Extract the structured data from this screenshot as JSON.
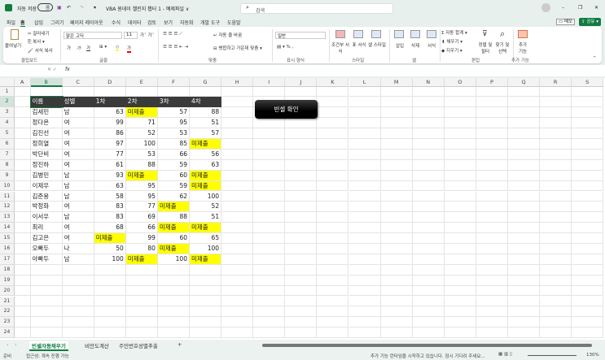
{
  "titlebar": {
    "autosave": "자동 저장",
    "toggle": "끔",
    "title": "VBA 원데이 챌린지 챕터 1 - 예제파일 ∨",
    "search_placeholder": "검색"
  },
  "tabs": [
    "파일",
    "홈",
    "삽입",
    "그리기",
    "페이지 레이아웃",
    "수식",
    "데이터",
    "검토",
    "보기",
    "자동화",
    "개발 도구",
    "도움말"
  ],
  "actions": {
    "memo": "메모",
    "share": "공유"
  },
  "ribbon": {
    "clipboard": {
      "paste": "붙여넣기",
      "cut": "잘라내기",
      "copy": "복사",
      "format_painter": "서식 복사",
      "label": "클립보드"
    },
    "font": {
      "name": "맑은 고딕",
      "size": "11",
      "bold": "가",
      "italic": "가",
      "underline": "가",
      "label": "글꼴"
    },
    "alignment": {
      "wrap": "자동 줄 바꿈",
      "merge": "병합하고 가운데 맞춤",
      "label": "맞춤"
    },
    "number": {
      "format": "일반",
      "percent": "%",
      "label": "표시 형식"
    },
    "styles": {
      "conditional": "조건부 서식",
      "table": "표 서식",
      "cell_styles": "셀 스타일",
      "label": "스타일"
    },
    "cells": {
      "insert": "삽입",
      "delete": "삭제",
      "format": "서식",
      "label": "셀"
    },
    "editing": {
      "autosum": "자동 합계",
      "fill": "채우기",
      "clear": "지우기",
      "sort": "정렬 및 필터",
      "find": "찾기 및 선택",
      "label": "편집"
    },
    "addins": {
      "addins": "추가 기능",
      "label": "추가 기능"
    }
  },
  "formula_bar": {
    "name_box": "B2",
    "fx": "fx",
    "value": "이름"
  },
  "columns": [
    "A",
    "B",
    "C",
    "D",
    "E",
    "F",
    "G",
    "H",
    "I",
    "J",
    "K",
    "L",
    "M",
    "N",
    "O",
    "P",
    "Q",
    "R",
    "S"
  ],
  "rows": [
    "1",
    "2",
    "3",
    "4",
    "5",
    "6",
    "7",
    "8",
    "9",
    "10",
    "11",
    "12",
    "13",
    "14",
    "15",
    "16",
    "17",
    "18",
    "19",
    "20",
    "21",
    "22",
    "23",
    "24"
  ],
  "table": {
    "headers": [
      "이름",
      "성별",
      "1차",
      "2차",
      "3차",
      "4차"
    ],
    "rows": [
      [
        "김세민",
        "남",
        "63",
        "미제출",
        "57",
        "88"
      ],
      [
        "정다온",
        "여",
        "99",
        "71",
        "95",
        "51"
      ],
      [
        "김진선",
        "여",
        "86",
        "52",
        "53",
        "57"
      ],
      [
        "정희열",
        "여",
        "97",
        "100",
        "85",
        "미제출"
      ],
      [
        "박단비",
        "여",
        "77",
        "53",
        "66",
        "56"
      ],
      [
        "정진하",
        "여",
        "61",
        "88",
        "59",
        "63"
      ],
      [
        "김병민",
        "남",
        "93",
        "미제출",
        "60",
        "미제출"
      ],
      [
        "이제우",
        "남",
        "63",
        "95",
        "59",
        "미제출"
      ],
      [
        "김준용",
        "남",
        "58",
        "95",
        "62",
        "100"
      ],
      [
        "박정화",
        "여",
        "83",
        "77",
        "미제출",
        "52"
      ],
      [
        "이서우",
        "남",
        "83",
        "69",
        "88",
        "51"
      ],
      [
        "최리",
        "여",
        "68",
        "66",
        "미제출",
        "미제출"
      ],
      [
        "김고은",
        "여",
        "미제출",
        "99",
        "60",
        "65"
      ],
      [
        "오빠두",
        "나",
        "50",
        "80",
        "미제출",
        "100"
      ],
      [
        "아빠두",
        "남",
        "100",
        "미제출",
        "100",
        "미제출"
      ]
    ]
  },
  "highlight_color": "#ffff00",
  "button": {
    "label": "빈셀 확인"
  },
  "sheets": [
    "빈셀자동채우기",
    "비만도계산",
    "주민번호성별추출"
  ],
  "add_sheet": "+",
  "status": {
    "ready": "준비",
    "accessibility": "접근성: 계속 진행 가능",
    "message": "추가 기능 런타임을 시작하고 있습니다. 잠시 기다려 주세요...",
    "zoom": "130%"
  }
}
